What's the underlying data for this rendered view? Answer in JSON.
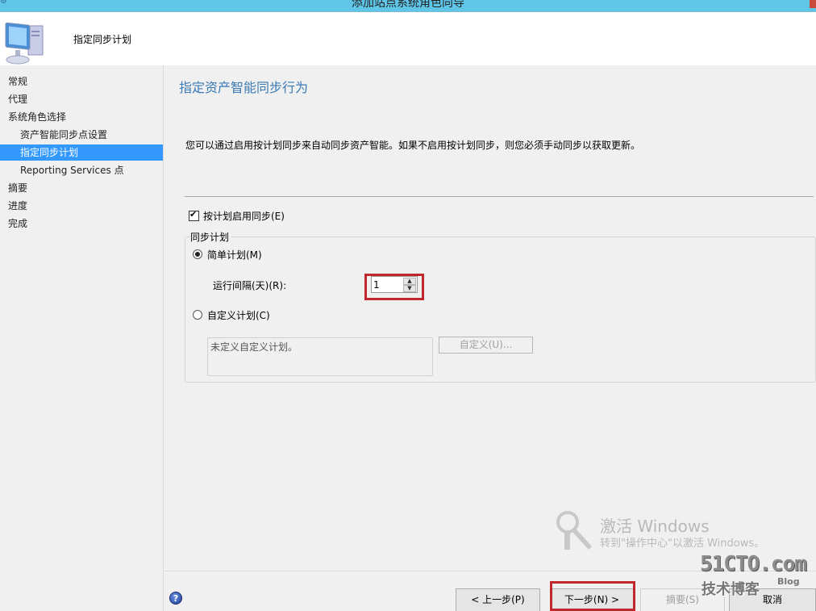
{
  "window": {
    "title": "添加站点系统角色向导",
    "icons": {
      "app": "wizard-app-icon",
      "close": "close-icon"
    }
  },
  "header": {
    "title": "指定同步计划",
    "icon": "computer-icon"
  },
  "sidebar": {
    "items": [
      {
        "label": "常规",
        "level": 0,
        "active": false
      },
      {
        "label": "代理",
        "level": 0,
        "active": false
      },
      {
        "label": "系统角色选择",
        "level": 0,
        "active": false
      },
      {
        "label": "资产智能同步点设置",
        "level": 1,
        "active": false
      },
      {
        "label": "指定同步计划",
        "level": 1,
        "active": true
      },
      {
        "label": "Reporting Services 点",
        "level": 1,
        "active": false
      },
      {
        "label": "摘要",
        "level": 0,
        "active": false
      },
      {
        "label": "进度",
        "level": 0,
        "active": false
      },
      {
        "label": "完成",
        "level": 0,
        "active": false
      }
    ]
  },
  "main": {
    "heading": "指定资产智能同步行为",
    "description": "您可以通过启用按计划同步来自动同步资产智能。如果不启用按计划同步，则您必须手动同步以获取更新。",
    "enable_checkbox": {
      "label": "按计划启用同步(E)",
      "checked": true
    },
    "schedule_group": {
      "label": "同步计划",
      "simple": {
        "label": "简单计划(M)",
        "selected": true
      },
      "interval": {
        "label": "运行间隔(天)(R):",
        "value": "1"
      },
      "custom": {
        "label": "自定义计划(C)",
        "selected": false
      },
      "custom_text": "未定义自定义计划。",
      "custom_button": "自定义(U)..."
    }
  },
  "watermark": {
    "title": "激活 Windows",
    "subtitle": "转到\"操作中心\"以激活 Windows。",
    "blog_big": "51CTO.com",
    "blog_small": "技术博客",
    "blog_tag": "Blog"
  },
  "footer": {
    "help": "?",
    "back": "< 上一步(P)",
    "next": "下一步(N) >",
    "summary": "摘要(S)",
    "cancel": "取消"
  },
  "colors": {
    "titlebar": "#5fc6e8",
    "selection": "#3399ff",
    "heading": "#3a7ab5",
    "highlight_frame": "#c0282e"
  }
}
